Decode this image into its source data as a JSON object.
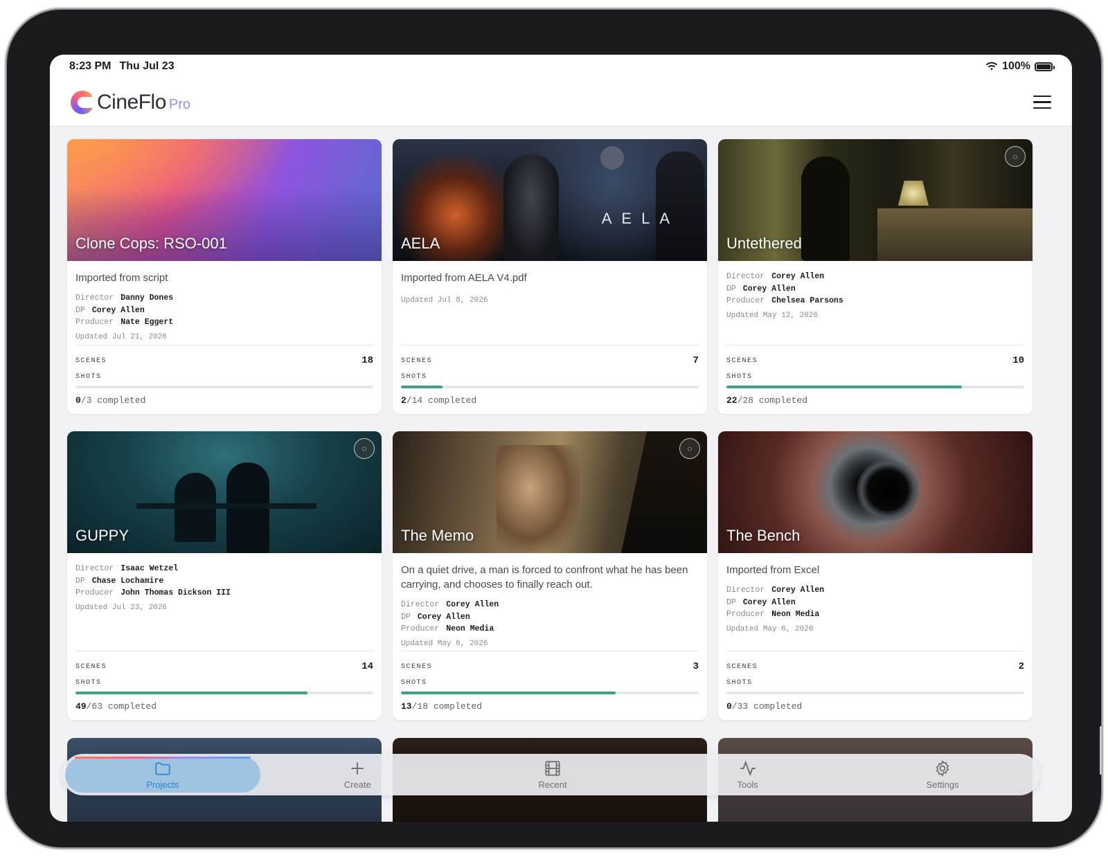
{
  "status_bar": {
    "time": "8:23 PM",
    "date": "Thu Jul 23",
    "battery": "100%"
  },
  "app": {
    "brand": "CineFlo",
    "brand_suffix": "Pro"
  },
  "labels": {
    "director": "Director",
    "dp": "DP",
    "producer": "Producer",
    "scenes": "SCENES",
    "shots": "SHOTS",
    "completed_suffix": " completed"
  },
  "projects": [
    {
      "title": "Clone Cops: RSO-001",
      "description": "Imported from script",
      "director": "Danny Dones",
      "dp": "Corey Allen",
      "producer": "Nate Eggert",
      "updated": "Updated Jul 21, 2026",
      "scenes": "18",
      "shots_done": "0",
      "shots_total": "/3",
      "progress": 0,
      "collaborative": false
    },
    {
      "title": "AELA",
      "tagline": "AELA",
      "description": "Imported from AELA V4.pdf",
      "updated": "Updated Jul 8, 2026",
      "scenes": "7",
      "shots_done": "2",
      "shots_total": "/14",
      "progress": 0.14,
      "collaborative": false
    },
    {
      "title": "Untethered",
      "director": "Corey Allen",
      "dp": "Corey Allen",
      "producer": "Chelsea Parsons",
      "updated": "Updated May 12, 2026",
      "scenes": "10",
      "shots_done": "22",
      "shots_total": "/28",
      "progress": 0.79,
      "collaborative": true
    },
    {
      "title": "GUPPY",
      "director": "Isaac Wetzel",
      "dp": "Chase Lochamire",
      "producer": "John Thomas Dickson III",
      "updated": "Updated Jul 23, 2026",
      "scenes": "14",
      "shots_done": "49",
      "shots_total": "/63",
      "progress": 0.78,
      "collaborative": true
    },
    {
      "title": "The Memo",
      "description": "On a quiet drive, a man is forced to confront what he has been carrying, and chooses to finally reach out.",
      "director": "Corey Allen",
      "dp": "Corey Allen",
      "producer": "Neon Media",
      "updated": "Updated May 6, 2026",
      "scenes": "3",
      "shots_done": "13",
      "shots_total": "/18",
      "progress": 0.72,
      "collaborative": true
    },
    {
      "title": "The Bench",
      "description": "Imported from Excel",
      "director": "Corey Allen",
      "dp": "Corey Allen",
      "producer": "Neon Media",
      "updated": "Updated May 6, 2026",
      "scenes": "2",
      "shots_done": "0",
      "shots_total": "/33",
      "progress": 0,
      "collaborative": false
    }
  ],
  "tabs": [
    {
      "label": "Projects",
      "icon": "folder-icon",
      "active": true
    },
    {
      "label": "Create",
      "icon": "plus-icon",
      "active": false
    },
    {
      "label": "Recent",
      "icon": "film-icon",
      "active": false
    },
    {
      "label": "Tools",
      "icon": "activity-icon",
      "active": false
    },
    {
      "label": "Settings",
      "icon": "gear-icon",
      "active": false
    }
  ]
}
